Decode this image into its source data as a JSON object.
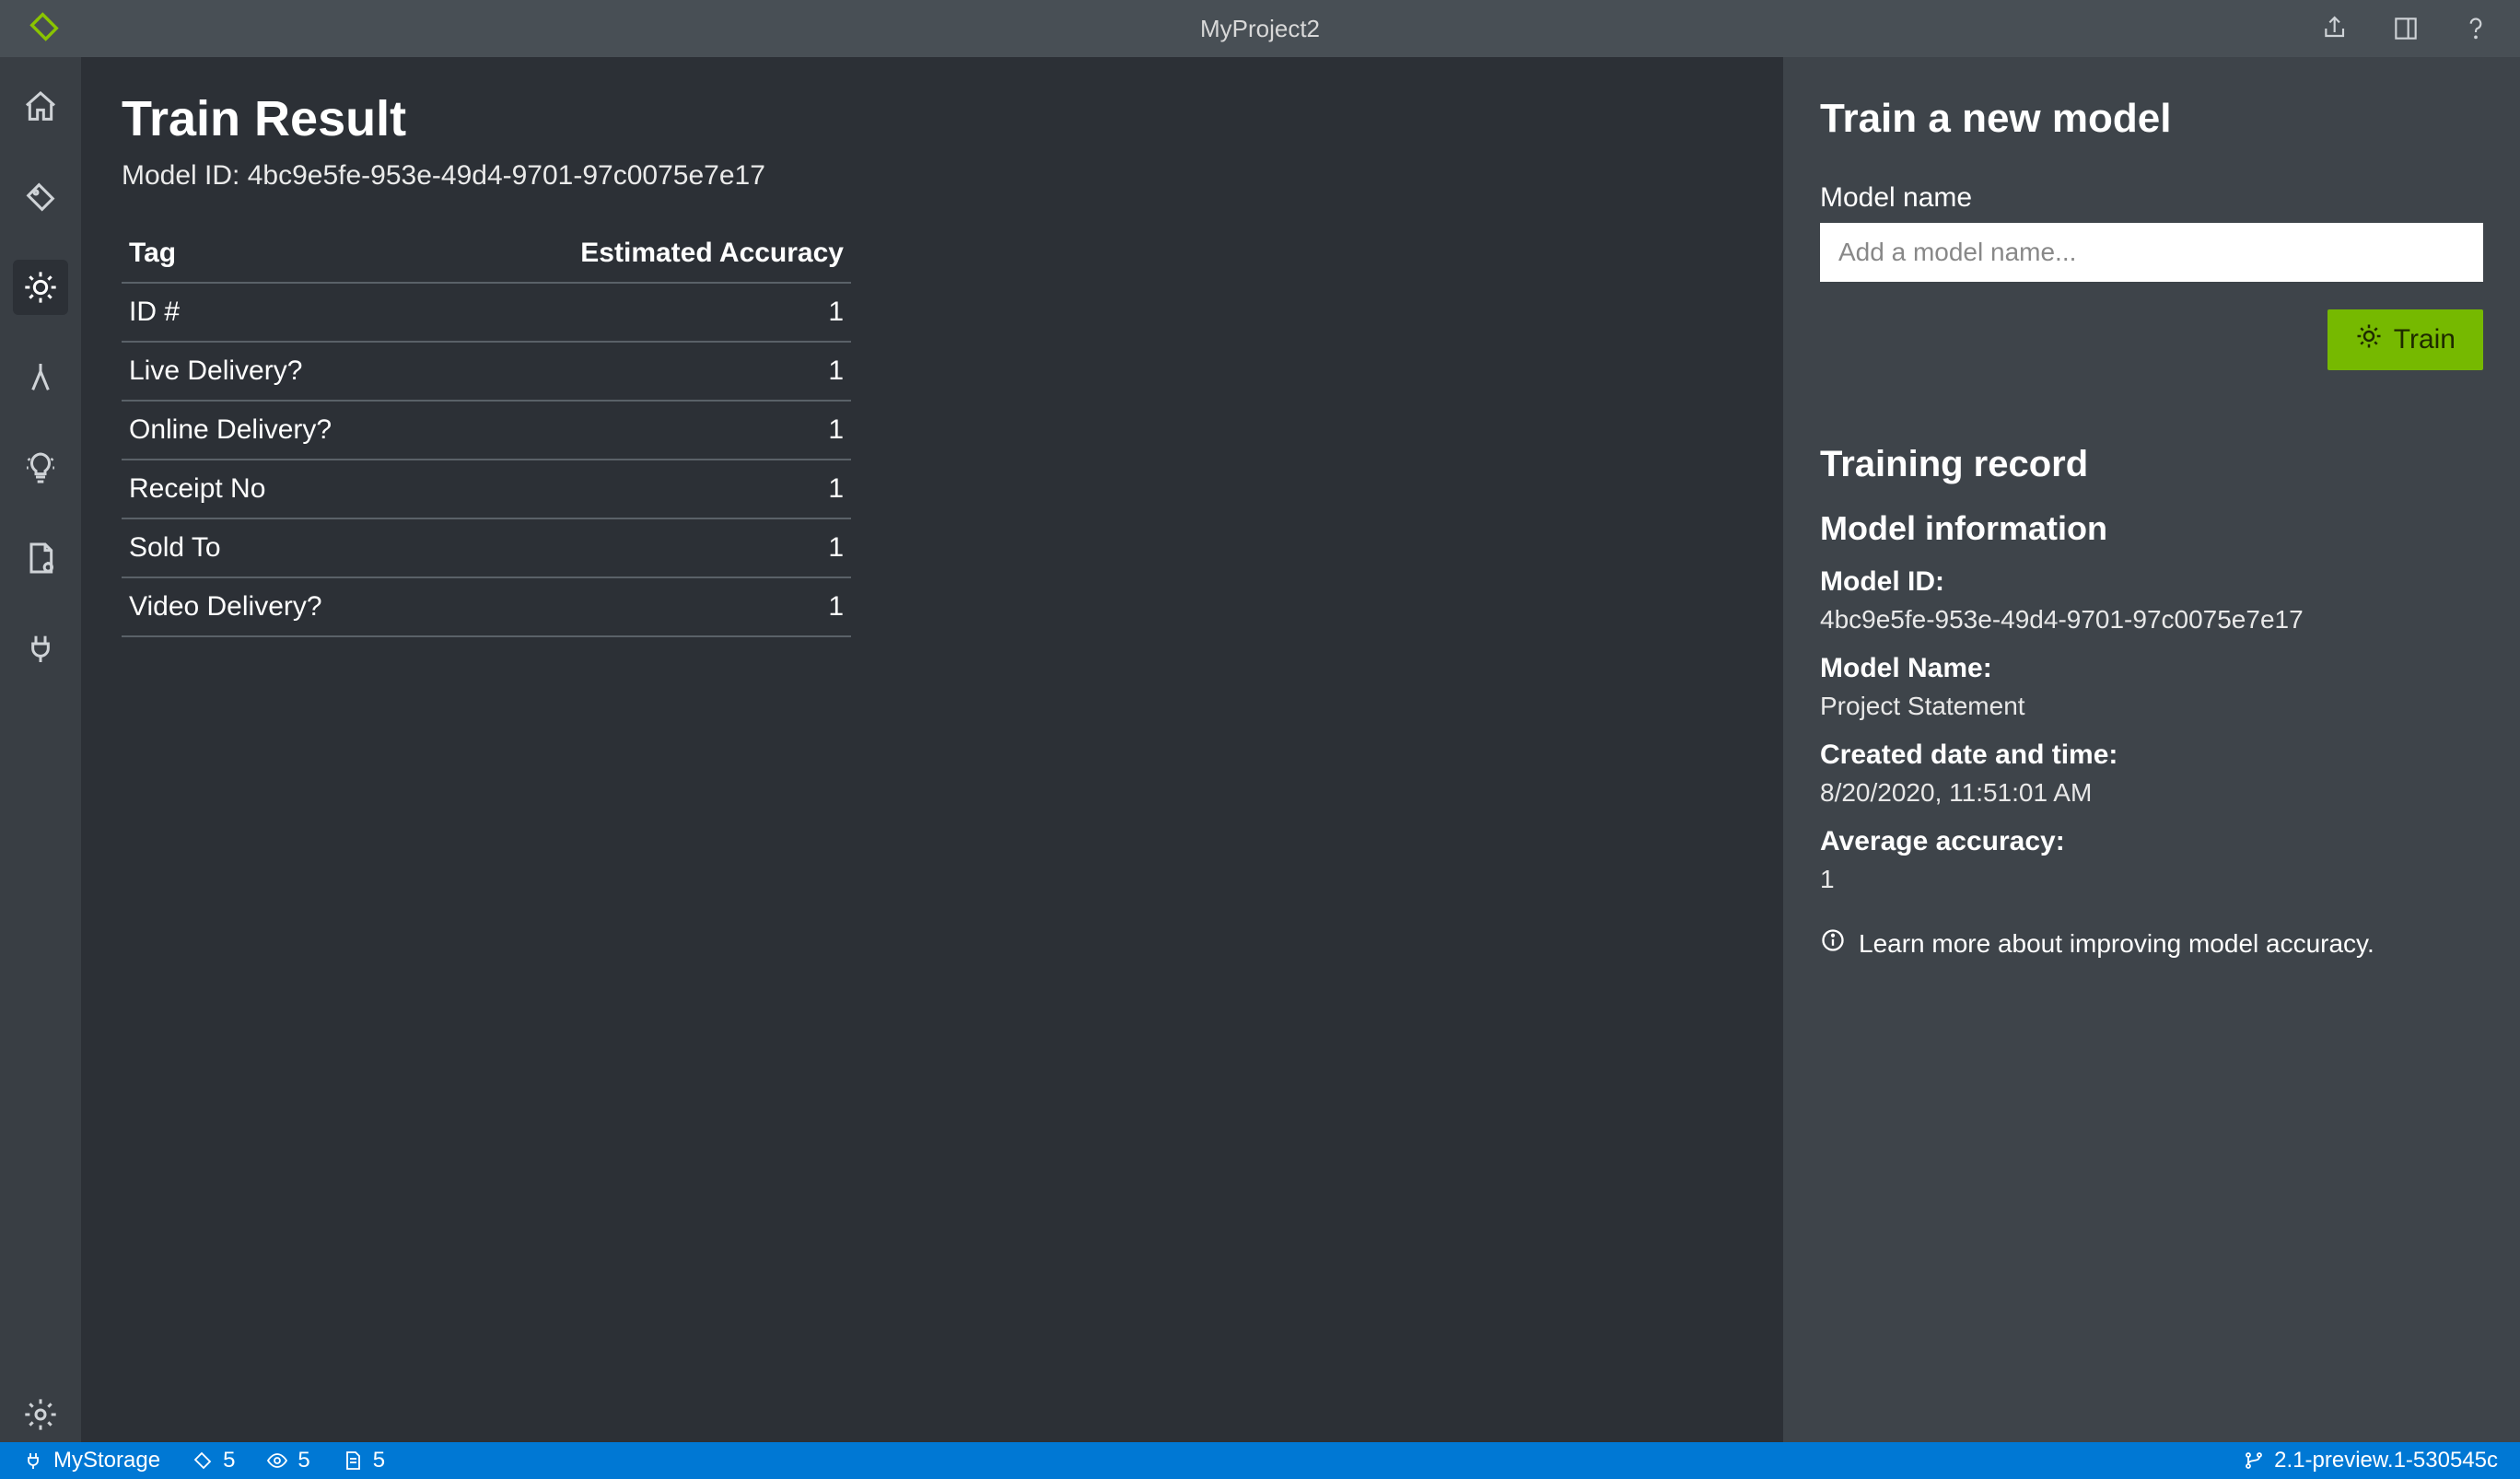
{
  "app": {
    "project_title": "MyProject2"
  },
  "main": {
    "title": "Train Result",
    "model_id_prefix": "Model ID:",
    "model_id": "4bc9e5fe-953e-49d4-9701-97c0075e7e17",
    "table": {
      "headers": {
        "tag": "Tag",
        "accuracy": "Estimated Accuracy"
      },
      "rows": [
        {
          "tag": "ID #",
          "accuracy": "1"
        },
        {
          "tag": "Live Delivery?",
          "accuracy": "1"
        },
        {
          "tag": "Online Delivery?",
          "accuracy": "1"
        },
        {
          "tag": "Receipt No",
          "accuracy": "1"
        },
        {
          "tag": "Sold To",
          "accuracy": "1"
        },
        {
          "tag": "Video Delivery?",
          "accuracy": "1"
        }
      ]
    }
  },
  "rightPanel": {
    "train_new_model_heading": "Train a new model",
    "model_name_label": "Model name",
    "model_name_placeholder": "Add a model name...",
    "train_button_label": "Train",
    "training_record_heading": "Training record",
    "model_info_heading": "Model information",
    "info": {
      "model_id_label": "Model ID:",
      "model_id_value": "4bc9e5fe-953e-49d4-9701-97c0075e7e17",
      "model_name_label": "Model Name:",
      "model_name_value": "Project Statement",
      "created_label": "Created date and time:",
      "created_value": "8/20/2020, 11:51:01 AM",
      "avg_acc_label": "Average accuracy:",
      "avg_acc_value": "1"
    },
    "learn_more_text": "Learn more about improving model accuracy."
  },
  "statusbar": {
    "storage_label": "MyStorage",
    "tag_count": "5",
    "view_count": "5",
    "doc_count": "5",
    "version": "2.1-preview.1-530545c"
  }
}
